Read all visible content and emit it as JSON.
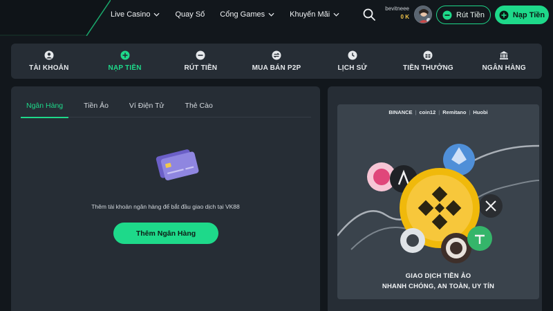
{
  "header": {
    "nav": [
      {
        "label": "Live Casino",
        "has_dropdown": true
      },
      {
        "label": "Quay Số",
        "has_dropdown": false
      },
      {
        "label": "Cổng Games",
        "has_dropdown": true
      },
      {
        "label": "Khuyến Mãi",
        "has_dropdown": true
      }
    ],
    "user": {
      "name": "bevitneee",
      "balance": "0 K"
    },
    "withdraw_label": "Rút Tiền",
    "deposit_label": "Nạp Tiền",
    "accent_color": "#1ed98a"
  },
  "account_tabs": [
    {
      "label": "TÀI KHOẢN",
      "icon": "user-circle-icon",
      "active": false
    },
    {
      "label": "NẠP TIỀN",
      "icon": "plus-circle-icon",
      "active": true
    },
    {
      "label": "RÚT TIỀN",
      "icon": "minus-circle-icon",
      "active": false
    },
    {
      "label": "MUA BÁN P2P",
      "icon": "exchange-icon",
      "active": false
    },
    {
      "label": "LỊCH SỬ",
      "icon": "clock-icon",
      "active": false
    },
    {
      "label": "TIỀN THƯỞNG",
      "icon": "gift-icon",
      "active": false
    },
    {
      "label": "NGÂN HÀNG",
      "icon": "bank-icon",
      "active": false
    }
  ],
  "deposit_methods": {
    "tabs": [
      {
        "label": "Ngân Hàng",
        "active": true
      },
      {
        "label": "Tiền Ảo",
        "active": false
      },
      {
        "label": "Ví Điện Tử",
        "active": false
      },
      {
        "label": "Thẻ Cào",
        "active": false
      }
    ],
    "empty_message": "Thêm tài khoản ngân hàng để bắt đầu giao dịch tại VK88",
    "add_bank_label": "Thêm Ngân Hàng"
  },
  "promo": {
    "partners": [
      "BINANCE",
      "coin12",
      "Remitano",
      "Huobi"
    ],
    "line1": "GIAO DỊCH TIỀN ẢO",
    "line2": "NHANH CHÓNG, AN TOÀN, UY TÍN"
  }
}
